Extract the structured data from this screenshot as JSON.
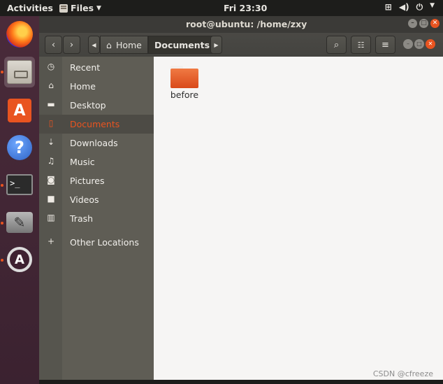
{
  "topbar": {
    "activities": "Activities",
    "app_menu": "Files",
    "clock": "Fri 23:30"
  },
  "launcher": {
    "items": [
      {
        "name": "firefox",
        "icon": "firefox-icon"
      },
      {
        "name": "files",
        "icon": "files-icon",
        "active": true
      },
      {
        "name": "software",
        "icon": "software-store-icon",
        "glyph": "A"
      },
      {
        "name": "help",
        "icon": "help-icon",
        "glyph": "?"
      },
      {
        "name": "terminal",
        "icon": "terminal-icon",
        "glyph": ">_"
      },
      {
        "name": "tools",
        "icon": "tools-icon"
      },
      {
        "name": "software-updater",
        "icon": "software-updater-icon",
        "glyph": "A"
      }
    ]
  },
  "window": {
    "title": "root@ubuntu: /home/zxy",
    "breadcrumbs": {
      "home": "Home",
      "current": "Documents"
    },
    "sidebar": {
      "items": [
        {
          "label": "Recent",
          "icon": "clock-icon"
        },
        {
          "label": "Home",
          "icon": "home-icon"
        },
        {
          "label": "Desktop",
          "icon": "desktop-folder-icon"
        },
        {
          "label": "Documents",
          "icon": "document-icon",
          "active": true
        },
        {
          "label": "Downloads",
          "icon": "download-icon"
        },
        {
          "label": "Music",
          "icon": "music-icon"
        },
        {
          "label": "Pictures",
          "icon": "camera-icon"
        },
        {
          "label": "Videos",
          "icon": "video-icon"
        },
        {
          "label": "Trash",
          "icon": "trash-icon"
        },
        {
          "label": "Other Locations",
          "icon": "plus-icon"
        }
      ]
    },
    "files": [
      {
        "name": "before",
        "type": "folder"
      }
    ]
  },
  "watermark": "CSDN @cfreeze",
  "colors": {
    "accent": "#e95420",
    "sidebar": "#5f5d55",
    "toolbar": "#403f3b",
    "topbar": "#1d1d1b"
  }
}
